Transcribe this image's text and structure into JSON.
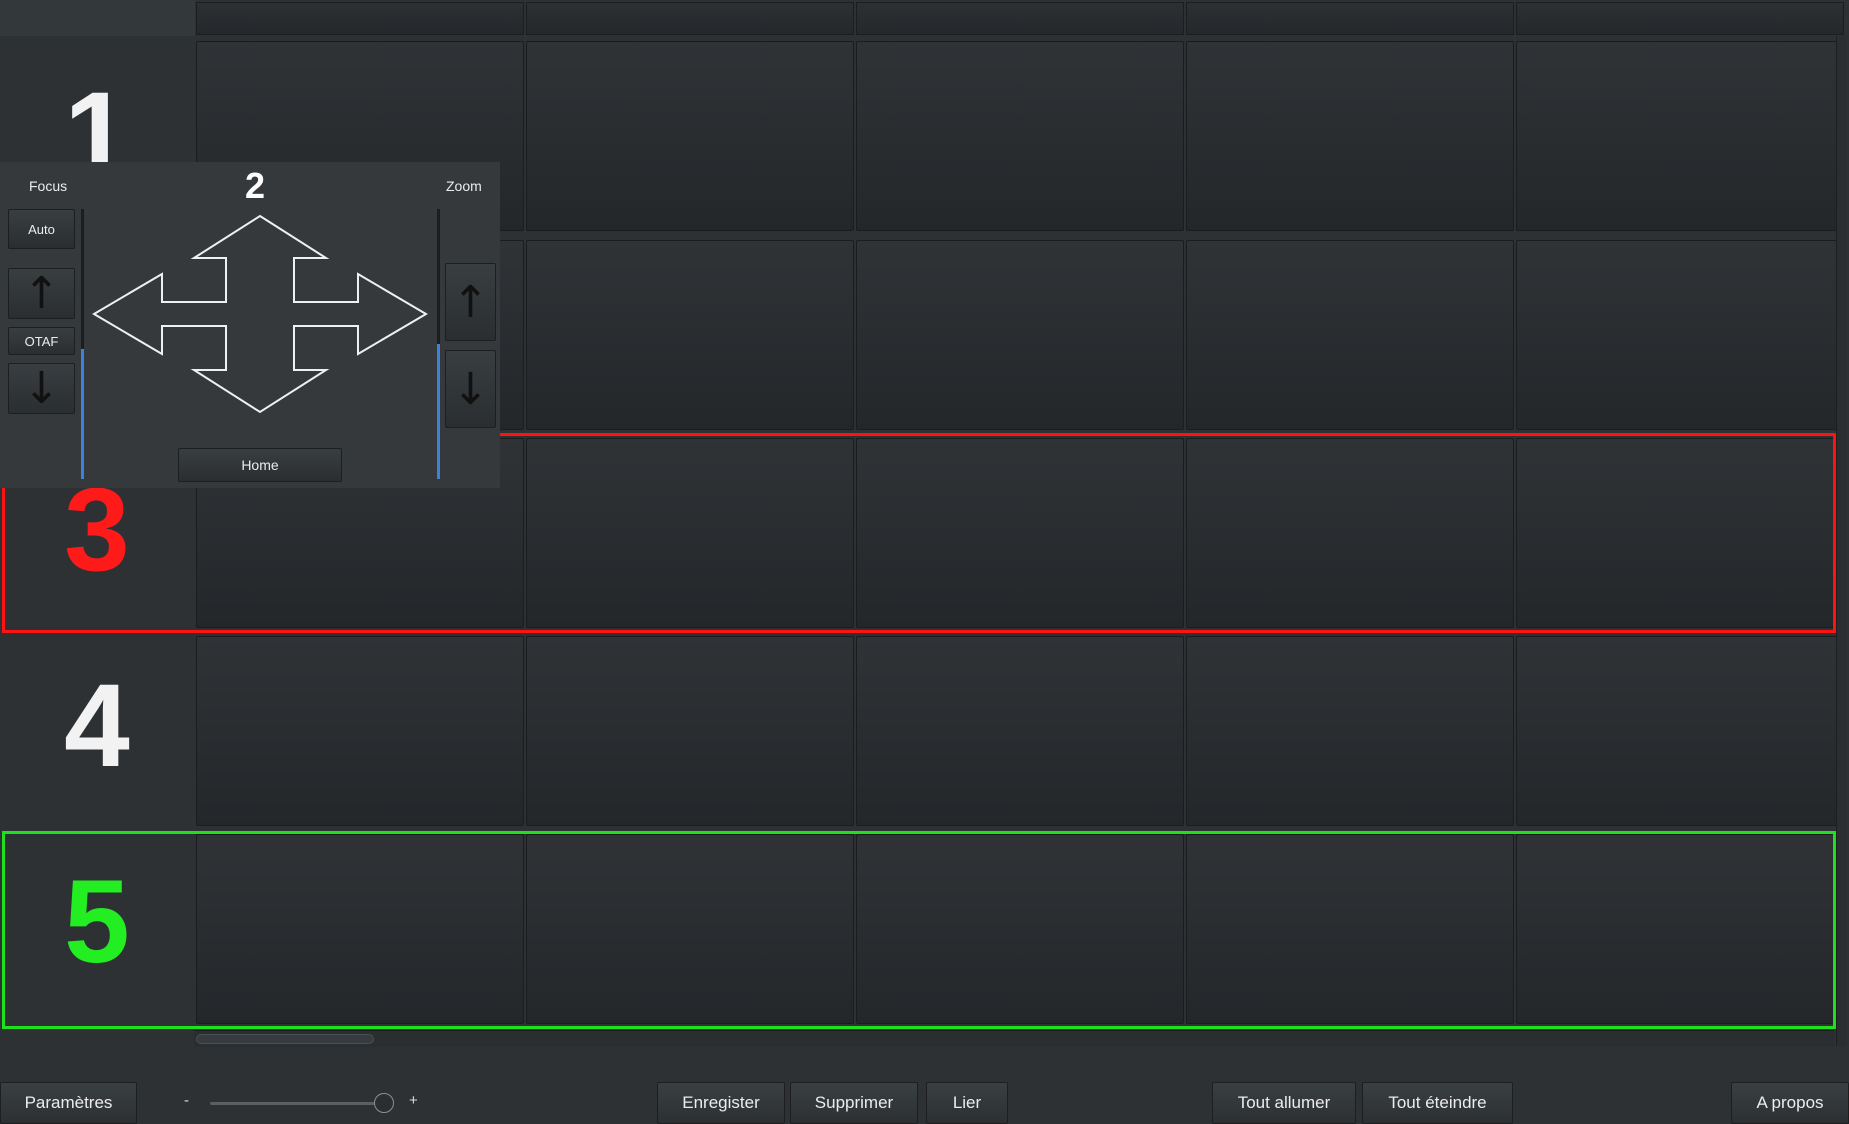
{
  "grid": {
    "rows": [
      {
        "label": "1",
        "highlight": "none"
      },
      {
        "label": "2",
        "highlight": "none"
      },
      {
        "label": "3",
        "highlight": "#ff1212"
      },
      {
        "label": "4",
        "highlight": "none"
      },
      {
        "label": "5",
        "highlight": "#1ee01e"
      }
    ]
  },
  "ptz_panel": {
    "title": "2",
    "focus_label": "Focus",
    "zoom_label": "Zoom",
    "auto_label": "Auto",
    "otaf_label": "OTAF",
    "home_label": "Home",
    "up_arrow": "↑",
    "down_arrow": "↓"
  },
  "toolbar": {
    "settings": "Paramètres",
    "zoom_minus": "-",
    "zoom_plus": "+",
    "save": "Enregister",
    "delete": "Supprimer",
    "link": "Lier",
    "all_on": "Tout allumer",
    "all_off": "Tout éteindre",
    "about": "A propos"
  },
  "colors": {
    "red_highlight": "#ff1212",
    "green_highlight": "#1ee01e",
    "accent_blue": "#3b82d8"
  }
}
